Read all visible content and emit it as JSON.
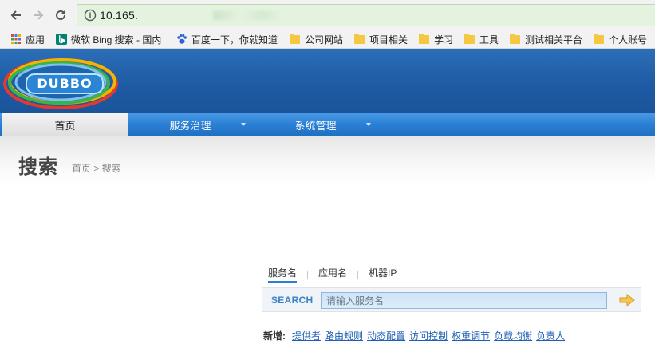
{
  "browser": {
    "url": "10.165.",
    "bookmarks": [
      {
        "label": "应用",
        "icon": "apps-grid-icon"
      },
      {
        "label": "微软 Bing 搜索 - 国内",
        "icon": "bing-icon"
      },
      {
        "label": "百度一下，你就知道",
        "icon": "baidu-paw-icon"
      },
      {
        "label": "公司网站",
        "icon": "folder-icon"
      },
      {
        "label": "项目相关",
        "icon": "folder-icon"
      },
      {
        "label": "学习",
        "icon": "folder-icon"
      },
      {
        "label": "工具",
        "icon": "folder-icon"
      },
      {
        "label": "测试相关平台",
        "icon": "folder-icon"
      },
      {
        "label": "个人账号",
        "icon": "folder-icon"
      }
    ]
  },
  "header": {
    "logo_text": "DUBBO"
  },
  "menu": {
    "items": [
      {
        "label": "首页",
        "active": true
      },
      {
        "label": "服务治理",
        "has_dropdown": true
      },
      {
        "label": "系统管理",
        "has_dropdown": true
      }
    ]
  },
  "page": {
    "title": "搜索",
    "breadcrumb": "首页 > 搜索"
  },
  "search": {
    "tabs": [
      "服务名",
      "应用名",
      "机器IP"
    ],
    "active_tab": "服务名",
    "label": "SEARCH",
    "placeholder": "请输入服务名",
    "value": ""
  },
  "quick_add": {
    "label": "新增:",
    "links": [
      "提供者",
      "路由规则",
      "动态配置",
      "访问控制",
      "权重调节",
      "负载均衡",
      "负责人"
    ]
  },
  "colors": {
    "banner": "#1d5aa3",
    "menu": "#2a7fd4",
    "link": "#1e5fb3",
    "search_label": "#3a82c8",
    "url_bar": "#e4f3df"
  }
}
